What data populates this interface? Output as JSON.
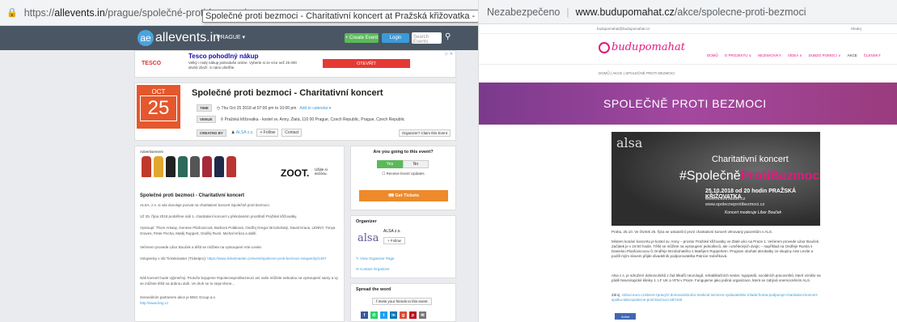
{
  "left": {
    "url_prefix": "https://",
    "url_host": "allevents.in",
    "url_path": "/prague/společné-proti-bezmoci",
    "tooltip": "Společné proti bezmoci - Charitativní koncert at Pražská křižovatka - kostel sv. Anny, Prague",
    "nav": {
      "logo_mark": "ae",
      "logo_text": "allevents.in",
      "city": "PRAGUE ▾",
      "create_label": "+ Create Event",
      "login_label": "Login",
      "search_placeholder": "Search Events"
    },
    "ad": {
      "brand": "TESCO",
      "title": "Tesco pohodlný nákup",
      "desc": "Velký i malý nákup jednoduše online. Vyberte si ze více než 25 000 druhů zboží. S námi ušetříte.",
      "open_label": "OTEVŘÍT",
      "ad_choice": "▷ ✕"
    },
    "event": {
      "month": "OCT",
      "day": "25",
      "title": "Společné proti bezmoci - Charitativní koncert",
      "time_tag": "TIME",
      "time_value": "Thu Oct 25 2018 at 07:00 pm to 10:00 pm",
      "time_link": "Add to calendar ▾",
      "venue_tag": "VENUE",
      "venue_value": "Pražská křižovatka - kostel sv. Anny, Zlatá, 110 00 Prague, Czech Republic, Prague, Czech Republic",
      "created_tag": "CREATED BY",
      "created_value": "ALSA z.s.",
      "follow_label": "+ Follow",
      "contact_label": "Contact",
      "claim_label": "Organizer? Claim this Event"
    },
    "main": {
      "adv_label": "Advertisement",
      "zoot": "ZOOT.",
      "zoot_sub": "Užijte si sezónu.",
      "heading": "Společné proti bezmoci - Charitativní koncert",
      "p1": "ALSA, z.s. si vás dovoluje pozvat na charitativní koncert Společně proti bezmoci.",
      "p2": "Už 25. října 2018 proběhne náš 1. charitativní koncert v překrásném prostředí Pražské křižovatky.",
      "p3": "Vystoupí: Thom Artway, Genese Pilařovicová, Barbora Poláková, Ondřej Gregor Brzobohatý, David Kraus, LENNY, Tonya Graves, Peter Pecha, Matěj Ruppert, Ondřej Ruml, Michal Hrůza a další.",
      "p4": "Večerem provede Libor Bouček a těšit se můžete na vystoupení Arte Levite.",
      "p5": "Vstupenky v síti Ticketmaster (Ticketpro):",
      "p5_link": "https://www.ticketmaster.cz/event/spolecne-proti-bezmoci-vstupenky/1487",
      "p6": "Náš koncert bude výjimečný. Protože bojujeme #spolecneprotibezmoci ani naše můžete nebudou na vystoupení samy a vy se můžete těšit na dobrou duši. Ve druh se to stoje těsne...",
      "p7": "Generálním partnerem akce je BNG Group a.s.",
      "p7_link": "http://www.bng.cz"
    },
    "sidebar": {
      "question": "Are you going to this event?",
      "yes": "Yes",
      "no": "No",
      "receive": "Receive Event Updates",
      "tickets": "Get Tickets",
      "organizer_label": "Organizer",
      "org_logo": "alsa",
      "org_name": "ALSA z.s.",
      "org_follow": "+ Follow",
      "org_link1": "View Organizer Page",
      "org_link2": "Contact Organizer",
      "spread_label": "Spread the word",
      "invite": "Invite your friends to this event"
    },
    "colors": {
      "calendar": "#e5572c",
      "nav": "#4a5663",
      "tickets": "#ee8a2b",
      "yes": "#5cb85c"
    }
  },
  "right": {
    "security": "Nezabezpečeno",
    "url_host": "www.budupomahat.cz",
    "url_path": "/akce/spolecne-proti-bezmoci",
    "mail": "budupomahat@budupomahat.cz",
    "search": "Hledej",
    "logo": "budupomahat",
    "menu": [
      "DOMŮ",
      "O PROJEKTU ∨",
      "NEZISKOVKY",
      "VÍDEA ∨",
      "DUBZO POMOCI ∨",
      "AKCE",
      "ČLENSKÝ"
    ],
    "breadcrumb": "DOMŮ | AKCE | SPOLEČNĚ PROTI BEZMOCI",
    "banner_title": "SPOLEČNĚ PROTI BEZMOCI",
    "poster": {
      "alsa": "alsa",
      "line1": "Charitativní koncert",
      "line2_a": "#Společně",
      "line2_b": "Proti",
      "line2_c": "Bezmoci",
      "line3": "25.10.2018 od 20 hodin PRAŽSKÁ KŘIŽOVATKA",
      "line4": "www.ticketmaster.cz",
      "line5": "www.spolecneprotibezmoci.cz",
      "line6": "Koncert moderuje Libor Bouček"
    },
    "t1": "Praha, 25.10. Ve čtvrtek 25. října se uskuteční první charitativní koncert věnovaný pacientům s ALS.",
    "t2": "Místem konání koncertu je kostel sv. Anny – prostor Pražské křižovatky ve Zlaté ulici na Praze 1. Večerem provede Libor Bouček. Začátek je v 19:00 hodin. Těšit se můžete na vystoupení jednotlivců, ale i uměleckých dvojic – například na Ondřeje Rumla s Danielou Pisařovicovou či Ondřeje Brzobohatého s Matějem Ruppertem. Program obohatí akrobatky ze skupiny Arte Levite a podílí mým slovem přijde divadelník podporovatelka Patricie Solaříková.",
    "t3": "Alsa z.s. je sdružení dobrovolníků z řad lékařů neurologů, rehabilitačních sester, logopedů, sociálních pracovníků, které vzniklo na půdě Neurologické kliniky 1. LF UK a VFN v Praze. Fungujeme jako jediná organizace, která se zabývá onemocněním ALS.",
    "t4_label": "Zdroj:",
    "t4_link": "zdravi.euro.cz/denni-zpravy/z-domova/dorobo-medical-services-vydavatelstvi-mlada-fronta-podporuje-charitativni-koncert-spolku-alsa-spolecne-proti-bezmoci-487445",
    "fb": "Sdílet"
  }
}
